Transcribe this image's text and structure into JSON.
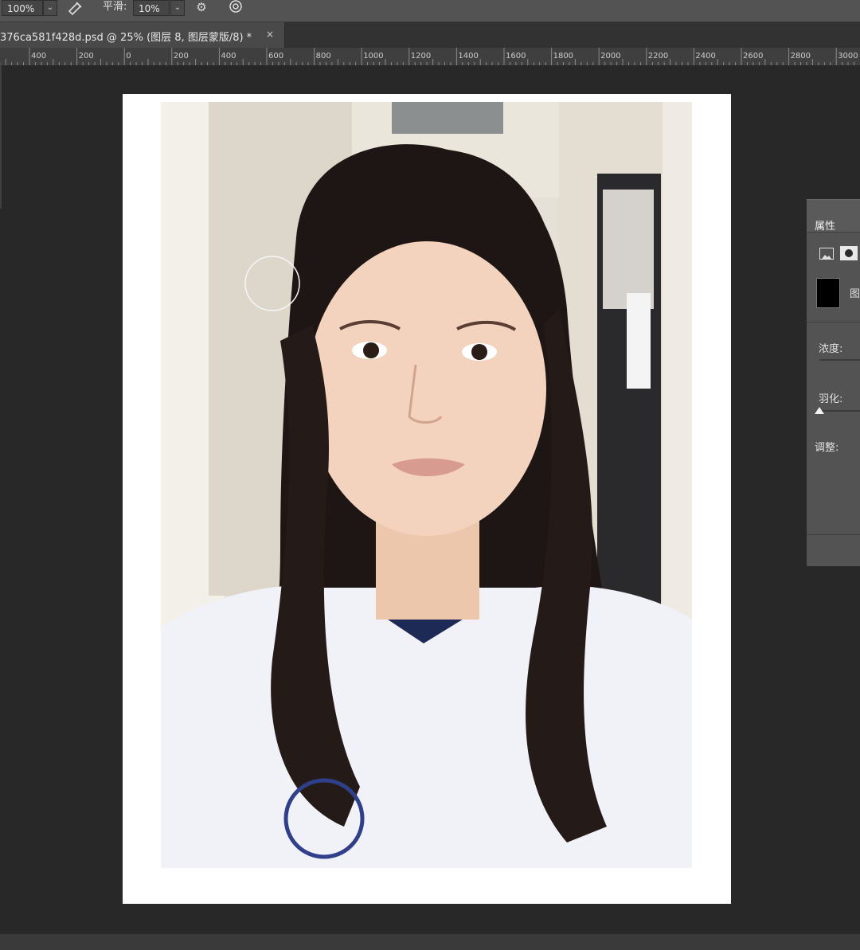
{
  "options_bar": {
    "zoom_value": "100%",
    "smooth_label": "平滑:",
    "smooth_value": "10%",
    "icons": [
      "airbrush-icon",
      "gear-icon",
      "pressure-icon"
    ]
  },
  "document_tab": {
    "title": "376ca581f428d.psd @ 25% (图层 8, 图层蒙版/8) *",
    "close": "×"
  },
  "ruler": {
    "labels": [
      "400",
      "200",
      "0",
      "200",
      "400",
      "600",
      "800",
      "1000",
      "1200",
      "1400",
      "1600",
      "1800",
      "2000",
      "2200",
      "2400",
      "2600",
      "2800",
      "3000"
    ]
  },
  "properties_panel": {
    "title": "属性",
    "layer_label": "图",
    "density_label": "浓度:",
    "feather_label": "羽化:",
    "adjust_label": "调整:"
  },
  "colors": {
    "workspace": "#282828",
    "toolbar": "#535353",
    "panel": "#535353",
    "ruler": "#3f3f3f"
  }
}
